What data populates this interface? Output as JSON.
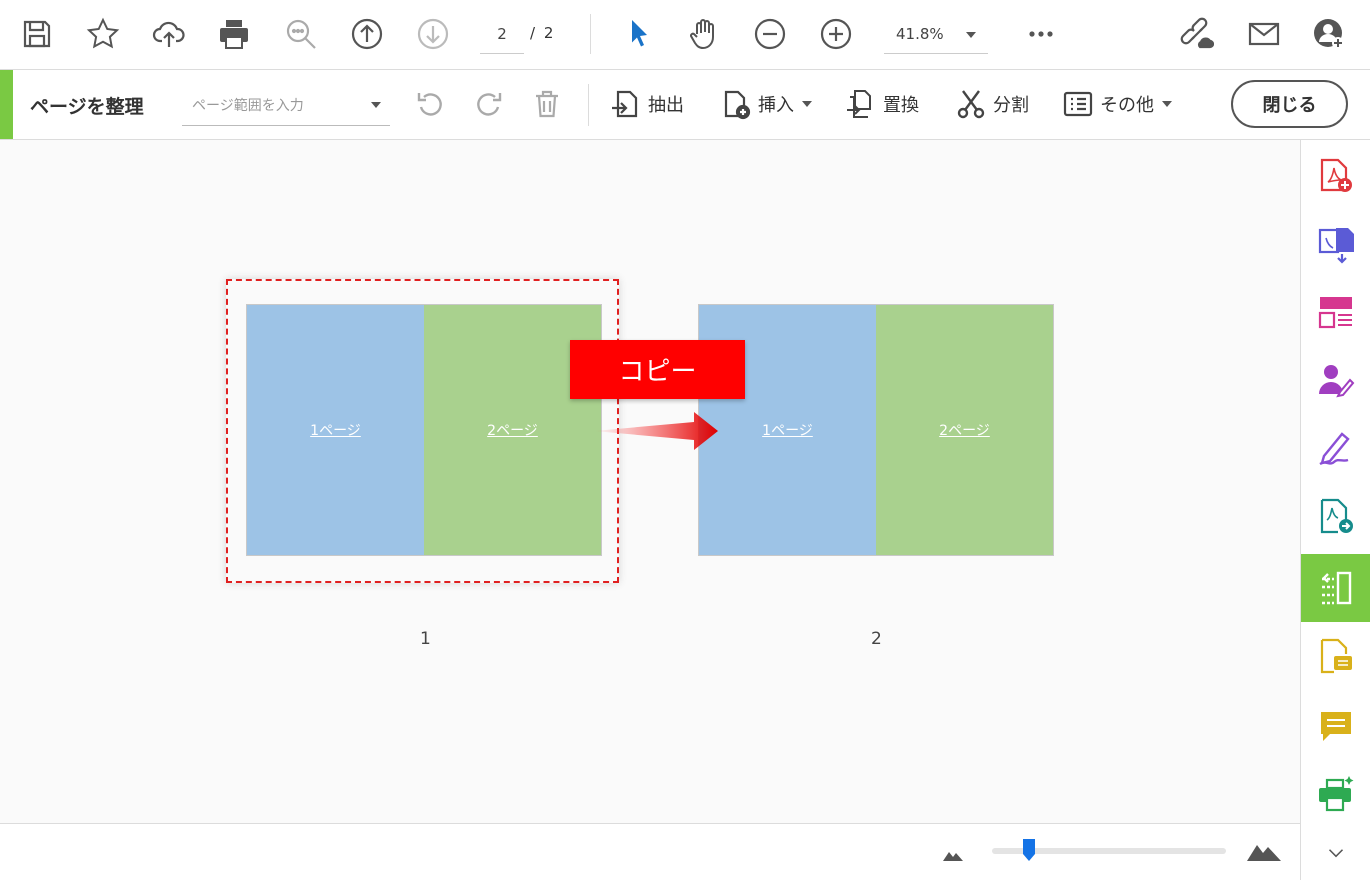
{
  "toolbar": {
    "icons": [
      "save-icon",
      "bookmark-star-icon",
      "cloud-upload-icon",
      "print-icon",
      "zoom-search-icon",
      "prev-page-icon",
      "next-page-icon",
      "select-arrow-icon",
      "hand-tool-icon",
      "zoom-out-icon",
      "zoom-in-icon",
      "more-icon",
      "share-link-icon",
      "email-icon",
      "account-icon"
    ],
    "current_page": "2",
    "total_pages": "/ 2",
    "zoom": "41.8%"
  },
  "organize": {
    "title": "ページを整理",
    "range_placeholder": "ページ範囲を入力",
    "extract_label": "抽出",
    "insert_label": "挿入",
    "replace_label": "置換",
    "split_label": "分割",
    "more_label": "その他",
    "close_label": "閉じる"
  },
  "pages": [
    {
      "number": "1",
      "left_label": "1ページ",
      "right_label": "2ページ"
    },
    {
      "number": "2",
      "left_label": "1ページ",
      "right_label": "2ページ"
    }
  ],
  "annotation": {
    "copy_label": "コピー"
  },
  "colors": {
    "accent": "#7ac943",
    "page_blue": "#9dc3e6",
    "page_green": "#a9d18e",
    "callout_red": "#ff0000"
  },
  "rail": [
    "create-pdf-icon",
    "export-pdf-icon",
    "edit-pdf-icon",
    "request-signature-icon",
    "fill-sign-icon",
    "send-review-icon",
    "organize-pages-icon",
    "comment-file-icon",
    "comment-icon",
    "print-production-icon",
    "expand-icon"
  ]
}
